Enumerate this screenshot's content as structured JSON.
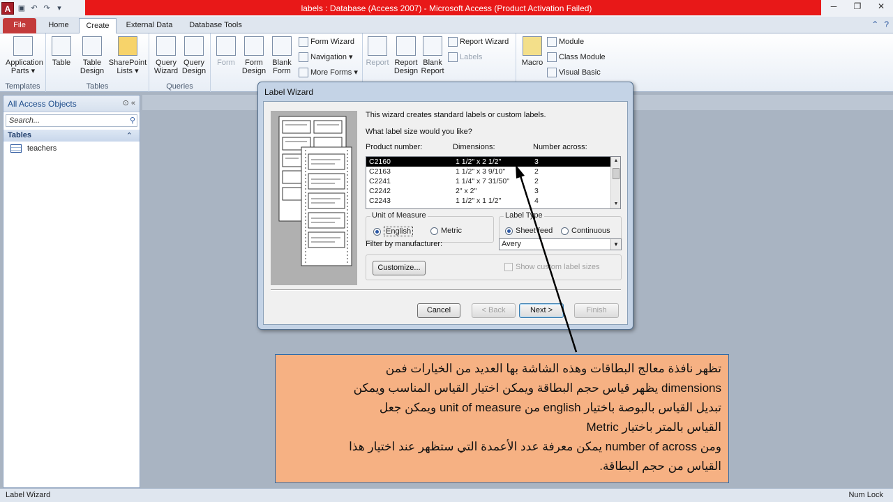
{
  "window": {
    "title": "labels : Database (Access 2007)  -  Microsoft Access (Product Activation Failed)"
  },
  "ribbon": {
    "tabs": [
      "File",
      "Home",
      "Create",
      "External Data",
      "Database Tools"
    ],
    "groups": {
      "templates": {
        "label": "Templates",
        "application_parts": "Application Parts ▾"
      },
      "tables": {
        "label": "Tables",
        "table": "Table",
        "table_design": "Table Design",
        "sharepoint_lists": "SharePoint Lists ▾"
      },
      "queries": {
        "label": "Queries",
        "query_wizard": "Query Wizard",
        "query_design": "Query Design"
      },
      "forms": {
        "form": "Form",
        "form_design": "Form Design",
        "blank_form": "Blank Form",
        "form_wizard": "Form Wizard",
        "navigation": "Navigation ▾",
        "more_forms": "More Forms ▾"
      },
      "reports": {
        "report": "Report",
        "report_design": "Report Design",
        "blank_report": "Blank Report",
        "report_wizard": "Report Wizard",
        "labels": "Labels"
      },
      "macros": {
        "macro": "Macro",
        "module": "Module",
        "class_module": "Class Module",
        "visual_basic": "Visual Basic"
      }
    }
  },
  "nav_pane": {
    "header": "All Access Objects",
    "search_placeholder": "Search...",
    "section": "Tables",
    "items": [
      "teachers"
    ]
  },
  "dialog": {
    "title": "Label Wizard",
    "intro": "This wizard creates standard labels or custom labels.",
    "question": "What label size would you like?",
    "columns": {
      "product": "Product number:",
      "dimensions": "Dimensions:",
      "across": "Number across:"
    },
    "rows": [
      {
        "product": "C2160",
        "dimensions": "1 1/2\" x 2 1/2\"",
        "across": "3"
      },
      {
        "product": "C2163",
        "dimensions": "1 1/2\" x 3 9/10\"",
        "across": "2"
      },
      {
        "product": "C2241",
        "dimensions": "1 1/4\" x 7 31/50\"",
        "across": "2"
      },
      {
        "product": "C2242",
        "dimensions": "2\" x 2\"",
        "across": "3"
      },
      {
        "product": "C2243",
        "dimensions": "1 1/2\" x 1 1/2\"",
        "across": "4"
      }
    ],
    "unit_of_measure": {
      "legend": "Unit of Measure",
      "english": "English",
      "metric": "Metric",
      "selected": "English"
    },
    "label_type": {
      "legend": "Label Type",
      "sheet_feed": "Sheet feed",
      "continuous": "Continuous",
      "selected": "Sheet feed"
    },
    "filter_label": "Filter by  manufacturer:",
    "manufacturer": "Avery",
    "customize": "Customize...",
    "show_custom": "Show custom label sizes",
    "buttons": {
      "cancel": "Cancel",
      "back": "< Back",
      "next": "Next >",
      "finish": "Finish"
    }
  },
  "callout": {
    "lines": [
      "تظهر نافذة معالج البطاقات وهذه الشاشة بها العديد من الخيارات فمن",
      "dimensions يظهر قياس حجم البطاقة ويمكن اختيار القياس المناسب    ويمكن",
      "تبديل القياس بالبوصة باختيار english من unit of measure ويمكن جعل",
      "القياس بالمتر باختيار Metric",
      "ومن number of across يمكن معرفة عدد الأعمدة التي ستظهر عند اختيار هذا",
      "القياس من حجم البطاقة."
    ]
  },
  "status": {
    "left": "Label Wizard",
    "right": "Num Lock"
  },
  "colors": {
    "title_red": "#e81818",
    "callout_fill": "#f6b183",
    "selection": "#000000"
  }
}
